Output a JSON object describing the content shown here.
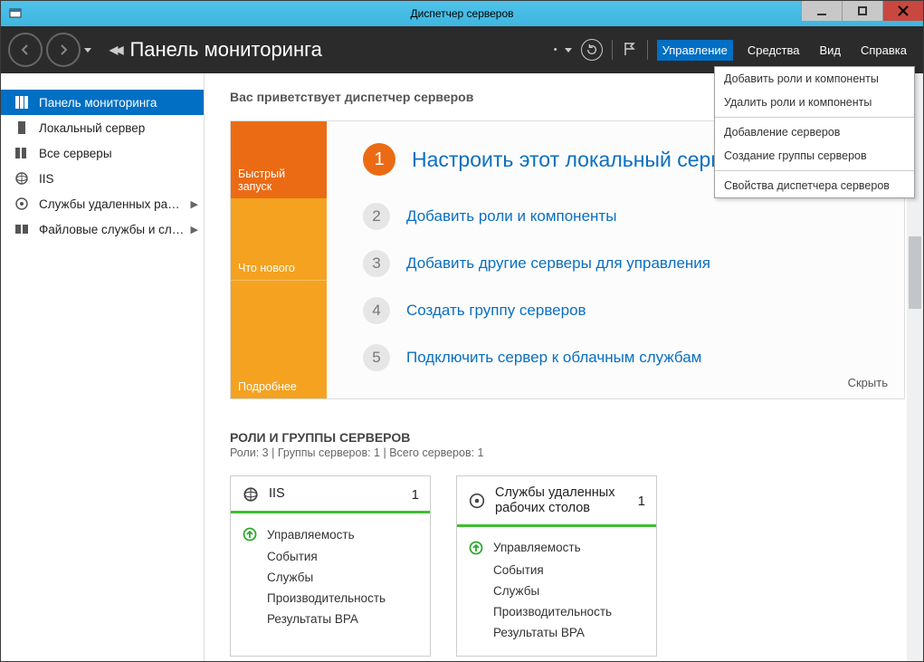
{
  "window": {
    "title": "Диспетчер серверов"
  },
  "toolbar": {
    "page_title": "Панель мониторинга",
    "menu": {
      "manage": "Управление",
      "tools": "Средства",
      "view": "Вид",
      "help": "Справка"
    }
  },
  "dropdown": {
    "items": [
      "Добавить роли и компоненты",
      "Удалить роли и компоненты",
      "Добавление серверов",
      "Создание группы серверов",
      "Свойства диспетчера серверов"
    ]
  },
  "sidebar": {
    "items": [
      {
        "label": "Панель мониторинга",
        "icon": "dashboard"
      },
      {
        "label": "Локальный сервер",
        "icon": "server"
      },
      {
        "label": "Все серверы",
        "icon": "servers"
      },
      {
        "label": "IIS",
        "icon": "iis"
      },
      {
        "label": "Службы удаленных ра…",
        "icon": "rds",
        "chev": true
      },
      {
        "label": "Файловые службы и сл…",
        "icon": "files",
        "chev": true
      }
    ]
  },
  "content": {
    "welcome_heading": "Вас приветствует диспетчер серверов",
    "tile_side": {
      "quick": "Быстрый запуск",
      "whatsnew": "Что нового",
      "more": "Подробнее"
    },
    "steps": [
      {
        "num": "1",
        "text": "Настроить этот локальный сервер"
      },
      {
        "num": "2",
        "text": "Добавить роли и компоненты"
      },
      {
        "num": "3",
        "text": "Добавить другие серверы для управления"
      },
      {
        "num": "4",
        "text": "Создать группу серверов"
      },
      {
        "num": "5",
        "text": "Подключить сервер к облачным службам"
      }
    ],
    "hide": "Скрыть",
    "roles_heading": "РОЛИ И ГРУППЫ СЕРВЕРОВ",
    "roles_sub": "Роли: 3 | Группы серверов: 1 | Всего серверов: 1",
    "role_tiles": [
      {
        "title": "IIS",
        "count": "1",
        "rows": [
          "Управляемость",
          "События",
          "Службы",
          "Производительность",
          "Результаты BPA"
        ]
      },
      {
        "title": "Службы удаленных рабочих столов",
        "count": "1",
        "rows": [
          "Управляемость",
          "События",
          "Службы",
          "Производительность",
          "Результаты BPA"
        ]
      }
    ]
  }
}
